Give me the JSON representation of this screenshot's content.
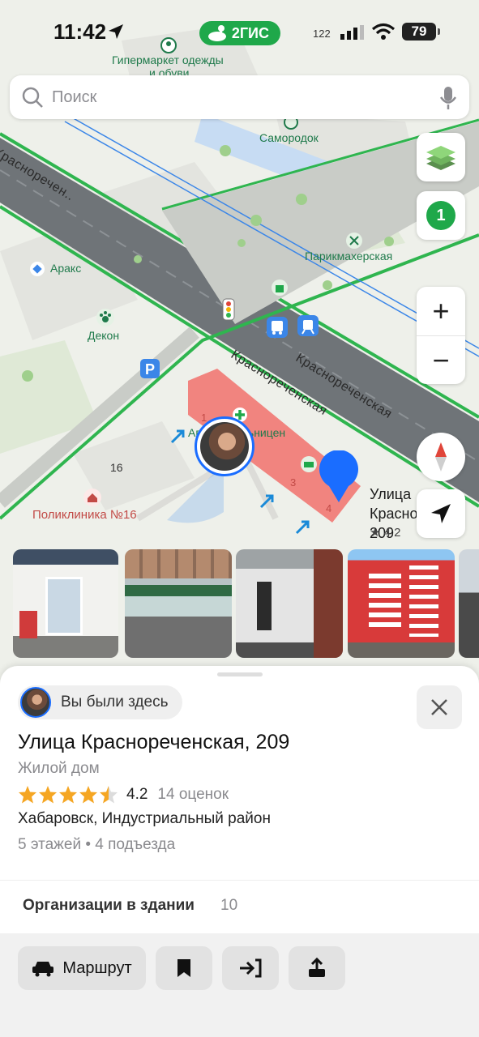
{
  "status_bar": {
    "time": "11:42",
    "brand": "2ГИС",
    "signal_label": "122",
    "battery": "79"
  },
  "search": {
    "placeholder": "Поиск"
  },
  "map": {
    "poi_labels": {
      "hypermarket_line1": "Гипермаркет одежды",
      "hypermarket_line2": "и обуви",
      "samorodok": "Самородок",
      "barber": "Парикмахерская",
      "araks": "Аракс",
      "dekon": "Декон",
      "pharmacy": "Аптека Больницен",
      "clinic": "Поликлиника №16",
      "house_number": "16"
    },
    "street_labels": {
      "left_street": "Красноречен..",
      "krasn_1": "Красноречен­ская",
      "krasn_2": "Красноречен­ская"
    },
    "entrances": [
      "1",
      "3",
      "4"
    ],
    "place_name_line1": "Улица Красноре…",
    "place_name_line2": "209",
    "place_rating": "★ 4.2",
    "counter_badge": "1",
    "zoom_in": "+",
    "zoom_out": "−"
  },
  "sheet": {
    "visited_label": "Вы были здесь",
    "title": "Улица Краснореченская, 209",
    "subtitle": "Жилой дом",
    "rating": {
      "value": "4.2",
      "count": "14 оценок",
      "stars_filled": 4.5
    },
    "city": "Хабаровск, Индустриальный район",
    "floors": "5 этажей • 4 подъезда",
    "orgs_label": "Организации в здании",
    "orgs_count": "10",
    "route_label": "Маршрут"
  },
  "colors": {
    "accent_green": "#1fa84a",
    "accent_blue": "#1a6dff",
    "star": "#f5a623"
  }
}
